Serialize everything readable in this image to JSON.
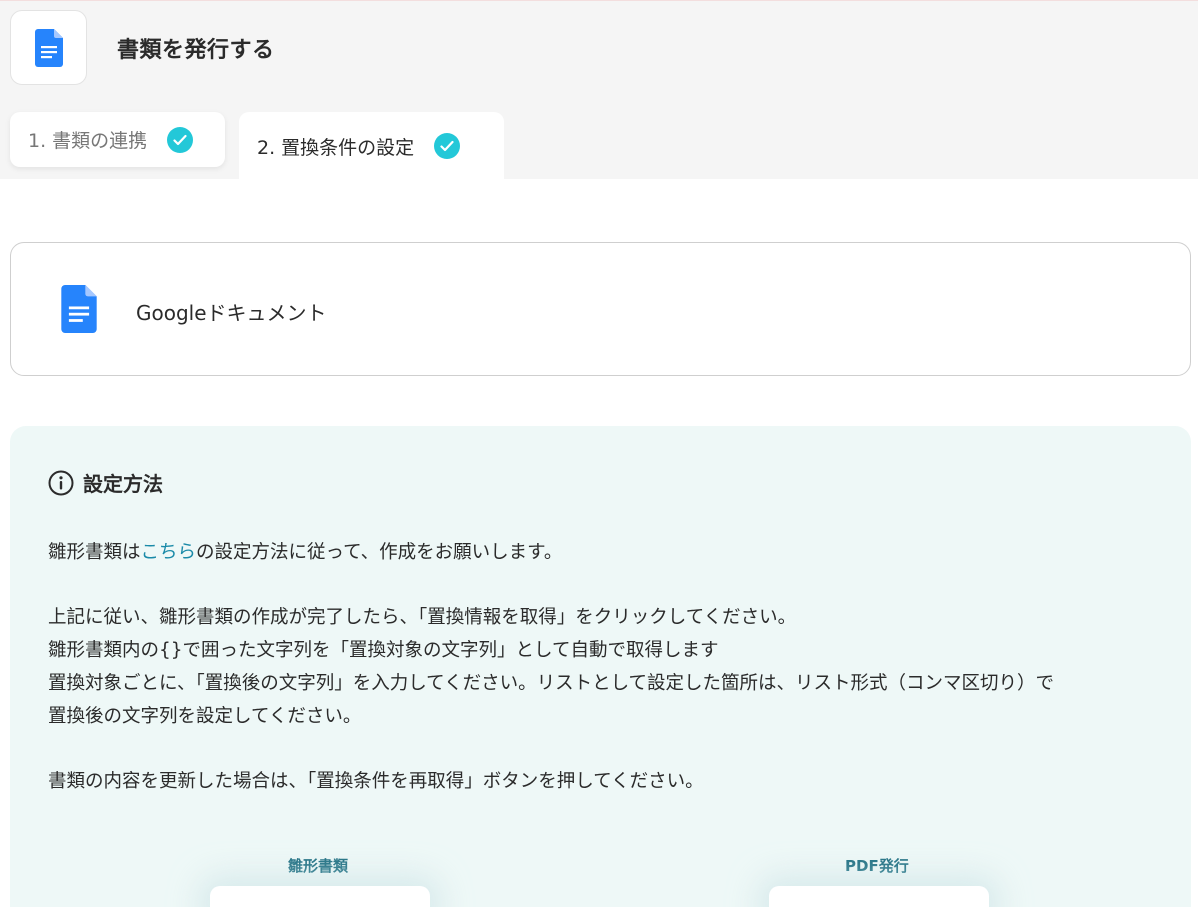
{
  "header": {
    "title": "書類を発行する",
    "app_icon": "google-docs-icon"
  },
  "tabs": [
    {
      "label": "1. 書類の連携",
      "completed": true
    },
    {
      "label": "2. 置換条件の設定",
      "completed": true,
      "active": true
    }
  ],
  "service": {
    "name": "Googleドキュメント",
    "icon": "google-docs-icon"
  },
  "info": {
    "icon": "info-icon",
    "title": "設定方法",
    "line1_before": "雛形書類は",
    "line1_link": "こちら",
    "line1_after": "の設定方法に従って、作成をお願いします。",
    "line2": "上記に従い、雛形書類の作成が完了したら、「置換情報を取得」をクリックしてください。",
    "line3": "雛形書類内の{}で囲った文字列を「置換対象の文字列」として自動で取得します",
    "line4": "置換対象ごとに、「置換後の文字列」を入力してください。リストとして設定した箇所は、リスト形式（コンマ区切り）で",
    "line5": "置換後の文字列を設定してください。",
    "line6": "書類の内容を更新した場合は、「置換条件を再取得」ボタンを押してください。"
  },
  "diagram": {
    "left_label": "雛形書類",
    "right_label": "PDF発行"
  },
  "colors": {
    "accent": "#23c8d8",
    "link": "#1a8aa8",
    "docs_blue": "#2684fc",
    "panel_bg": "#eef8f7"
  }
}
